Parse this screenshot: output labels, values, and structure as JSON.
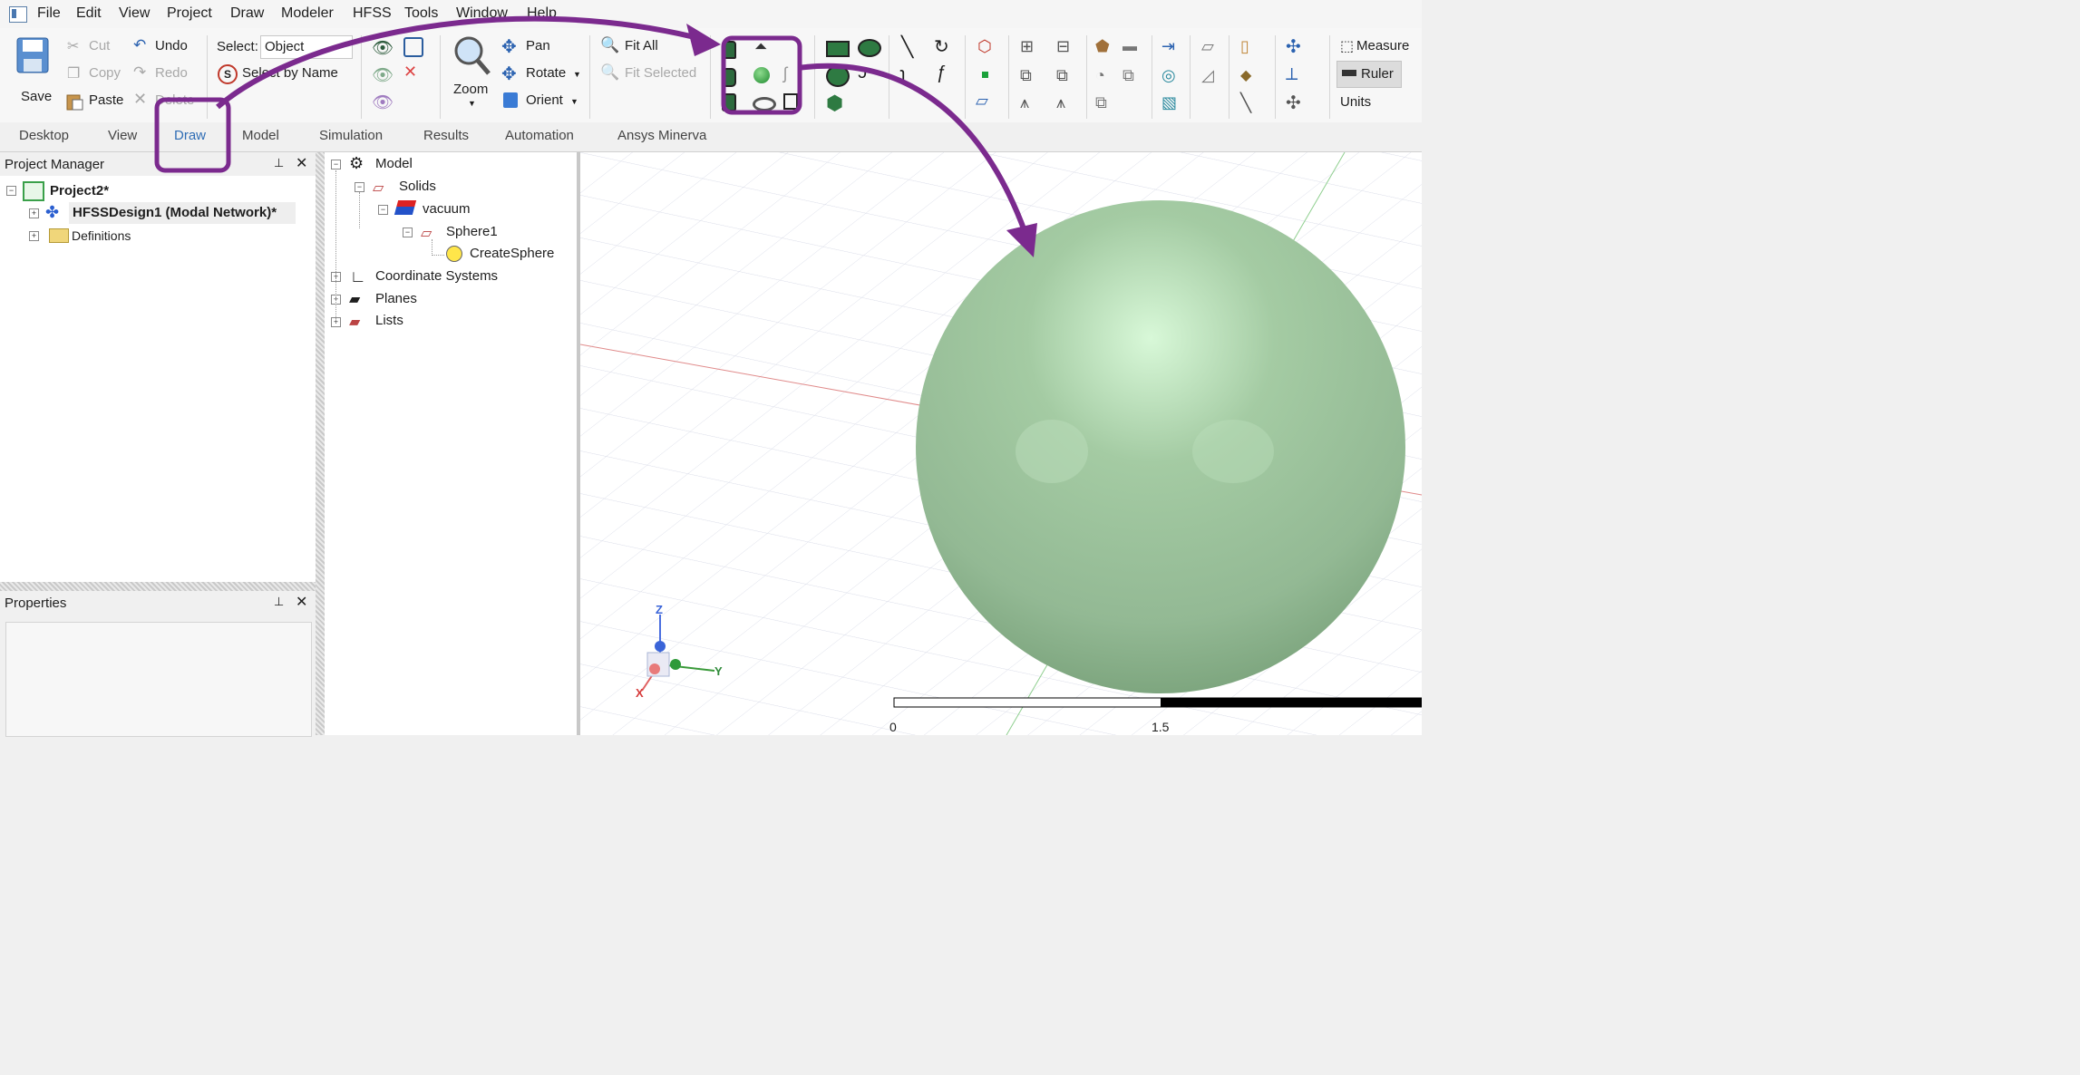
{
  "menu": [
    "File",
    "Edit",
    "View",
    "Project",
    "Draw",
    "Modeler",
    "HFSS",
    "Tools",
    "Window",
    "Help"
  ],
  "ribbon": {
    "save": "Save",
    "cut": "Cut",
    "copy": "Copy",
    "paste": "Paste",
    "undo": "Undo",
    "redo": "Redo",
    "delete": "Delete",
    "select_label": "Select:",
    "select_value": "Object",
    "select_by_name": "Select by Name",
    "zoom": "Zoom",
    "pan": "Pan",
    "rotate": "Rotate",
    "orient": "Orient",
    "fit_all": "Fit All",
    "fit_selected": "Fit Selected",
    "measure": "Measure",
    "ruler": "Ruler",
    "units": "Units"
  },
  "tabs": [
    "Desktop",
    "View",
    "Draw",
    "Model",
    "Simulation",
    "Results",
    "Automation",
    "Ansys Minerva"
  ],
  "active_tab": "Draw",
  "project_manager": {
    "title": "Project Manager",
    "project": "Project2*",
    "design": "HFSSDesign1 (Modal Network)*",
    "definitions": "Definitions"
  },
  "properties": {
    "title": "Properties"
  },
  "model_tree": {
    "model": "Model",
    "solids": "Solids",
    "vacuum": "vacuum",
    "sphere": "Sphere1",
    "create_sphere": "CreateSphere",
    "coordinate_systems": "Coordinate Systems",
    "planes": "Planes",
    "lists": "Lists"
  },
  "viewport": {
    "axis_z": "Z",
    "axis_y": "Y",
    "axis_x": "X",
    "scale_start": "0",
    "scale_mid": "1.5"
  },
  "colors": {
    "annotation": "#7b2a8e",
    "sphere": "#9dc39c",
    "tab_active": "#2f6db5"
  }
}
